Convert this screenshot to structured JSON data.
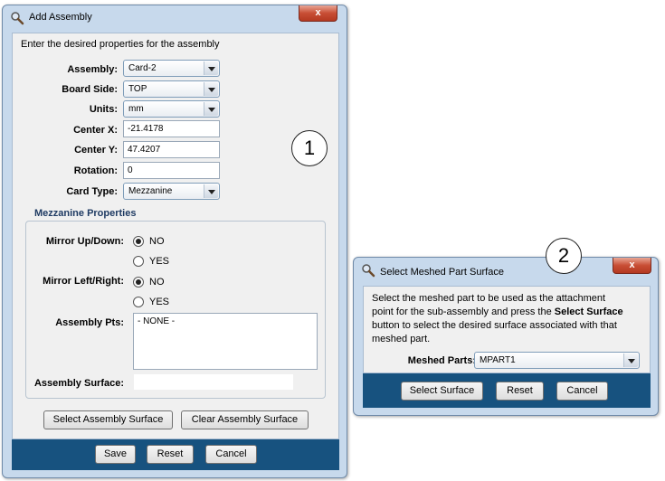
{
  "add_assembly": {
    "title": "Add Assembly",
    "close_label": "x",
    "intro": "Enter the desired properties for the assembly",
    "fields": {
      "assembly": {
        "label": "Assembly:",
        "value": "Card-2"
      },
      "board_side": {
        "label": "Board Side:",
        "value": "TOP"
      },
      "units": {
        "label": "Units:",
        "value": "mm"
      },
      "center_x": {
        "label": "Center X:",
        "value": "-21.4178"
      },
      "center_y": {
        "label": "Center Y:",
        "value": "47.4207"
      },
      "rotation": {
        "label": "Rotation:",
        "value": "0"
      },
      "card_type": {
        "label": "Card Type:",
        "value": "Mezzanine"
      }
    },
    "mezzanine": {
      "heading": "Mezzanine Properties",
      "mirror_up_down_label": "Mirror Up/Down:",
      "mirror_left_right_label": "Mirror Left/Right:",
      "option_no": "NO",
      "option_yes": "YES",
      "assembly_pts_label": "Assembly Pts:",
      "assembly_pts_value": "- NONE -",
      "assembly_surface_label": "Assembly Surface:",
      "assembly_surface_value": ""
    },
    "select_surface_button": "Select Assembly Surface",
    "clear_surface_button": "Clear Assembly Surface",
    "save_button": "Save",
    "reset_button": "Reset",
    "cancel_button": "Cancel",
    "callout": "1"
  },
  "select_meshed": {
    "title": "Select Meshed Part Surface",
    "close_label": "x",
    "instructions_1": "Select the meshed part to be used as the attachment",
    "instructions_2a": "point for the sub-assembly and press the ",
    "instructions_2b": "Select Surface",
    "instructions_3": "button to select the desired surface associated with that",
    "instructions_4": "meshed part.",
    "meshed_parts_label": "Meshed Parts:",
    "meshed_parts_value": "MPART1",
    "select_surface_button": "Select Surface",
    "reset_button": "Reset",
    "cancel_button": "Cancel",
    "callout": "2"
  },
  "colors": {
    "window_frame": "#c7d9ec",
    "footer": "#17527f",
    "close_button": "#c84e35",
    "panel": "#f0f0f0"
  }
}
